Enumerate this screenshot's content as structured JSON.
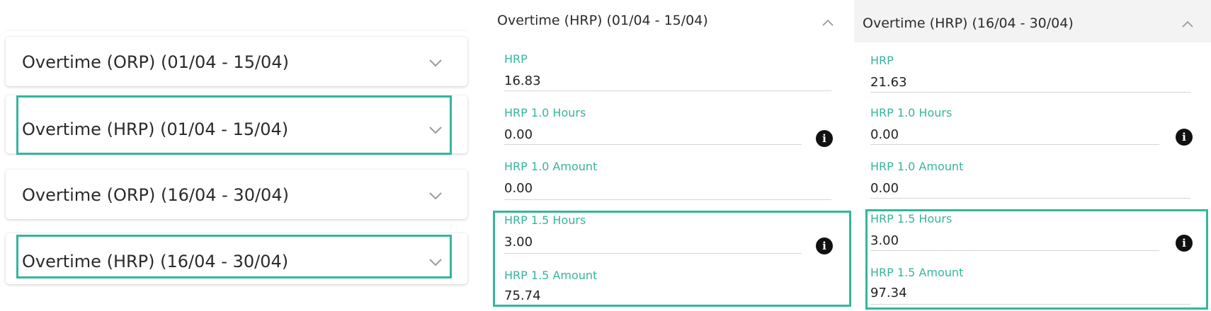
{
  "left_list": {
    "items": [
      {
        "title": "Overtime (ORP) (01/04 - 15/04)"
      },
      {
        "title": "Overtime (HRP) (01/04 - 15/04)"
      },
      {
        "title": "Overtime (ORP) (16/04 - 30/04)"
      },
      {
        "title": "Overtime (HRP) (16/04 - 30/04)"
      }
    ]
  },
  "panel1": {
    "title": "Overtime (HRP) (01/04 - 15/04)",
    "fields": [
      {
        "label": "HRP",
        "value": "16.83"
      },
      {
        "label": "HRP 1.0 Hours",
        "value": "0.00"
      },
      {
        "label": "HRP 1.0 Amount",
        "value": "0.00"
      },
      {
        "label": "HRP 1.5 Hours",
        "value": "3.00"
      },
      {
        "label": "HRP 1.5 Amount",
        "value": "75.74"
      }
    ]
  },
  "panel2": {
    "title": "Overtime (HRP) (16/04 - 30/04)",
    "fields": [
      {
        "label": "HRP",
        "value": "21.63"
      },
      {
        "label": "HRP 1.0 Hours",
        "value": "0.00"
      },
      {
        "label": "HRP 1.0 Amount",
        "value": "0.00"
      },
      {
        "label": "HRP 1.5 Hours",
        "value": "3.00"
      },
      {
        "label": "HRP 1.5 Amount",
        "value": "97.34"
      }
    ]
  },
  "icons": {
    "collapsed": "chevron-down-icon",
    "expanded": "chevron-up-icon",
    "info": "info-icon"
  },
  "colors": {
    "accent": "#35b59d",
    "highlight_border": "#35b59d",
    "header2_bg": "#f3f3f3"
  }
}
